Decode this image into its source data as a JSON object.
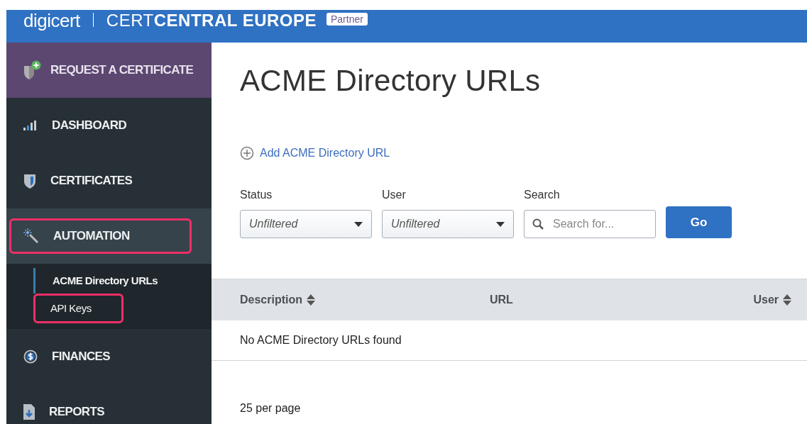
{
  "header": {
    "logo": "digicert",
    "product_light": "CERT",
    "product_bold": "CENTRAL EUROPE",
    "badge": "Partner"
  },
  "sidebar": {
    "request_button": "REQUEST A CERTIFICATE",
    "items": [
      {
        "label": "DASHBOARD",
        "kind": "dashboard",
        "expanded": false,
        "highlighted": false
      },
      {
        "label": "CERTIFICATES",
        "kind": "certificates",
        "expanded": false,
        "highlighted": false
      },
      {
        "label": "AUTOMATION",
        "kind": "automation",
        "expanded": true,
        "highlighted": true,
        "children": [
          {
            "label": "ACME Directory URLs",
            "selected": true,
            "highlighted": false
          },
          {
            "label": "API Keys",
            "selected": false,
            "highlighted": true
          }
        ]
      },
      {
        "label": "FINANCES",
        "kind": "finances",
        "expanded": false,
        "highlighted": false
      },
      {
        "label": "REPORTS",
        "kind": "reports",
        "expanded": false,
        "highlighted": false
      }
    ]
  },
  "main": {
    "title": "ACME Directory URLs",
    "add_link": "Add ACME Directory URL",
    "filters": [
      {
        "kind": "select",
        "label": "Status",
        "value": "Unfiltered"
      },
      {
        "kind": "select",
        "label": "User",
        "value": "Unfiltered"
      },
      {
        "kind": "search",
        "label": "Search",
        "placeholder": "Search for..."
      }
    ],
    "go_button": "Go",
    "table": {
      "columns": [
        {
          "label": "Description",
          "sortable": true
        },
        {
          "label": "URL",
          "sortable": false
        },
        {
          "label": "User",
          "sortable": true
        }
      ],
      "empty_message": "No ACME Directory URLs found"
    },
    "page_size": "25 per page"
  }
}
